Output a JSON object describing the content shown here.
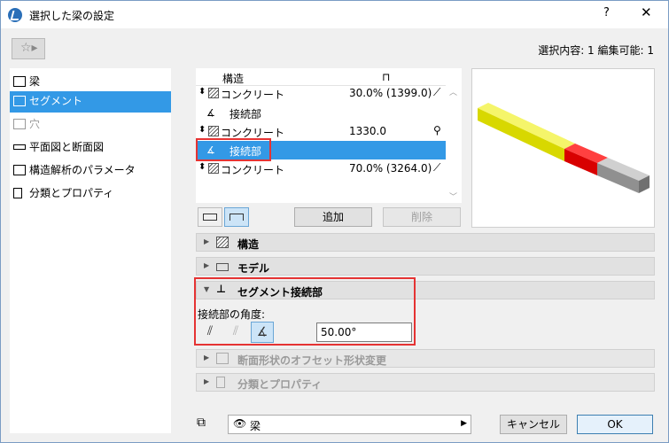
{
  "window": {
    "title": "選択した梁の設定",
    "help": "?",
    "close": "✕"
  },
  "selection_info": "選択内容: 1 編集可能: 1",
  "favorites_icon": "star-favorites",
  "nav": {
    "items": [
      {
        "label": "梁",
        "icon": "beam-icon",
        "state": "normal"
      },
      {
        "label": "セグメント",
        "icon": "segment-icon",
        "state": "selected"
      },
      {
        "label": "穴",
        "icon": "hole-icon",
        "state": "disabled"
      },
      {
        "label": "平面図と断面図",
        "icon": "floorplan-icon",
        "state": "normal"
      },
      {
        "label": "構造解析のパラメータ",
        "icon": "structural-icon",
        "state": "normal"
      },
      {
        "label": "分類とプロパティ",
        "icon": "classification-icon",
        "state": "normal"
      }
    ]
  },
  "segments": {
    "header": {
      "col1": "構造",
      "col2_icon": "dimension-icon"
    },
    "rows": [
      {
        "kind": "segment",
        "label": "コンクリート",
        "value": "30.0% (1399.0)",
        "icon": "⟋"
      },
      {
        "kind": "joint",
        "label": "接続部",
        "value": "",
        "icon": ""
      },
      {
        "kind": "segment",
        "label": "コンクリート",
        "value": "1330.0",
        "icon": "⚲"
      },
      {
        "kind": "joint",
        "label": "接続部",
        "value": "",
        "icon": "",
        "selected": true
      },
      {
        "kind": "segment",
        "label": "コンクリート",
        "value": "70.0% (3264.0)",
        "icon": "⟋"
      }
    ]
  },
  "buttons": {
    "add": "追加",
    "delete": "削除",
    "cancel": "キャンセル",
    "ok": "OK"
  },
  "panels": {
    "structure": "構造",
    "model": "モデル",
    "segment_joint": "セグメント接続部",
    "offset": "断面形状のオフセット形状変更",
    "classification": "分類とプロパティ"
  },
  "joint": {
    "angle_label": "接続部の角度:",
    "angle_value": "50.00°"
  },
  "layer": {
    "name": "梁"
  },
  "colors": {
    "selection": "#3399e6",
    "highlight_box": "#e53333",
    "beam_yellow": "#e8e800",
    "beam_red": "#e00000",
    "beam_gray": "#9a9a9a"
  }
}
